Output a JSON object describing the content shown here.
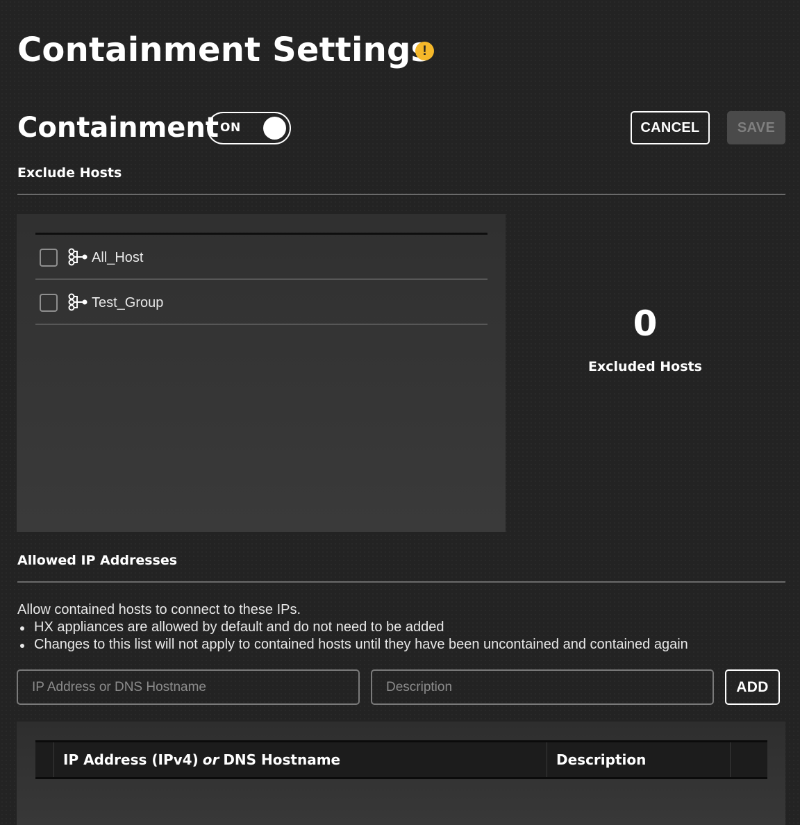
{
  "page": {
    "title": "Containment Settings",
    "warning_icon": "alert-circle-icon",
    "warning_glyph": "!",
    "accent_warning": "#f5b82a"
  },
  "containment": {
    "heading": "Containment",
    "toggle_label": "ON",
    "toggle_state": "on"
  },
  "toolbar": {
    "cancel_label": "CANCEL",
    "save_label": "SAVE",
    "save_disabled": true
  },
  "exclude_hosts": {
    "heading": "Exclude Hosts",
    "groups": [
      {
        "label": "All_Host",
        "icon": "host-group-icon",
        "checked": false
      },
      {
        "label": "Test_Group",
        "icon": "host-group-icon",
        "checked": false
      }
    ],
    "excluded_count": "0",
    "excluded_label": "Excluded Hosts"
  },
  "allowed_ips": {
    "heading": "Allowed IP Addresses",
    "intro": "Allow contained hosts to connect to these IPs.",
    "bullets": [
      "HX appliances are allowed by default and do not need to be added",
      "Changes to this list will not apply to contained hosts until they have been uncontained and contained again"
    ],
    "ip_placeholder": "IP Address or DNS Hostname",
    "ip_value": "",
    "desc_placeholder": "Description",
    "desc_value": "",
    "add_label": "ADD",
    "table": {
      "col_ip_a": "IP Address (IPv4)",
      "col_ip_or": "or",
      "col_ip_b": "DNS Hostname",
      "col_desc": "Description"
    }
  }
}
